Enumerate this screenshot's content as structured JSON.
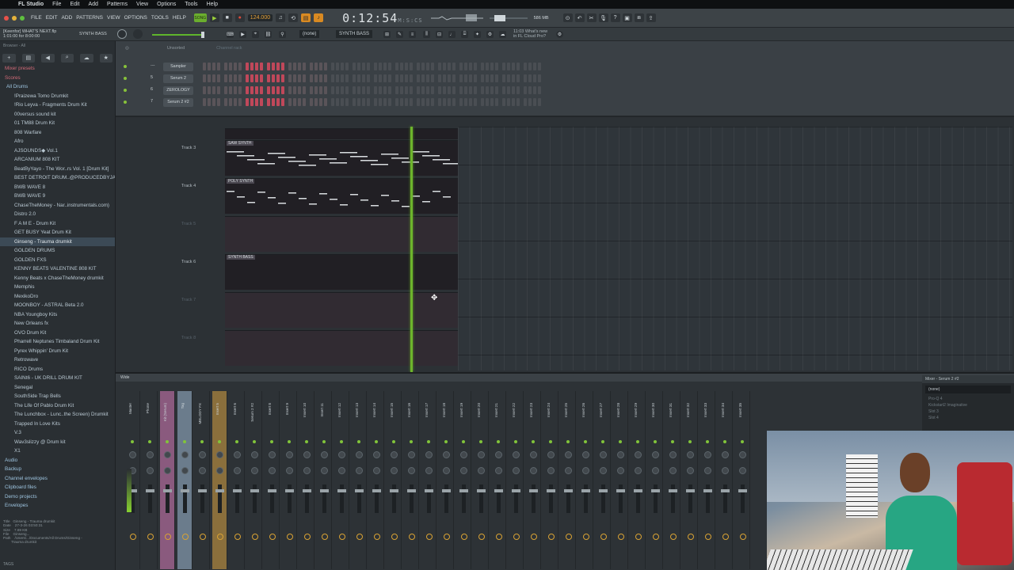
{
  "mac_menu": {
    "app": "FL Studio",
    "items": [
      "File",
      "Edit",
      "Add",
      "Patterns",
      "View",
      "Options",
      "Tools",
      "Help"
    ]
  },
  "toolbar": {
    "menu": [
      "FILE",
      "EDIT",
      "ADD",
      "PATTERNS",
      "VIEW",
      "OPTIONS",
      "TOOLS",
      "HELP"
    ],
    "mode": "SONG",
    "tempo": "124.000",
    "time": "0:12:54",
    "time_unit": "M:S:CS",
    "cpu": "586 MB",
    "cpu_sub": "0"
  },
  "hint": {
    "line1": "[Keenfor] WHAT'S NEXT.flp",
    "line2": "1:01:00 for 8:00:00"
  },
  "synth_label": "SYNTH BASS",
  "pattern_none": "(none)",
  "pattern_selector": "SYNTH BASS",
  "news": {
    "line1": "11:03 What's new",
    "line2": "in FL Cloud Pro?"
  },
  "browser": {
    "header": "Browser - All",
    "top": [
      "Mixer presets",
      "Scores"
    ],
    "folder": "All Drums",
    "items": [
      "!Praizewa Tomo Drumkit",
      "!Rio Leyva - Fragments Drum Kit",
      "00versus sound kit",
      "01 TM88 Drum Kit",
      "808 Warfare",
      "Afro",
      "AJSOUNDS◆ Vol.1",
      "ARCANIUM 808 KIT",
      "BeatByYayo - The Wor..rs Vol. 1 [Drum Kit]",
      "BEST DETROIT DRUM..@PRODUCEDBYJAVEN",
      "BWB WAVE 8",
      "BWB WAVE 9",
      "ChaseTheMoney - Nar..instrumentals.com)",
      "Distro 2.0",
      "F A M E - Drum Kit",
      "GET BUSY Yeat Drum Kit",
      "Ginseng - Trauma drumkit",
      "GOLDEN DRUMS",
      "GOLDEN FXS",
      "KENNY BEATS VALENTINE 808 KIT",
      "Kenny Beats x ChaseTheMoney drumkit",
      "Memphis",
      "MexikoDro",
      "MOONBOY - ASTRAL Beta 2.0",
      "NBA Youngboy Kits",
      "New Orleans fx",
      "OVO Drum Kit",
      "Pharrell Neptunes Timbaland Drum Kit",
      "Pyrex Whippin' Drum Kit",
      "Retrowave",
      "RICO Drums",
      "SAINt6 - UK DRILL DRUM KIT",
      "Senegal",
      "SouthSide Trap Bells",
      "The Life Of Pablo Drum Kit",
      "The Lunchbox - Lunc..the Screen) Drumkit",
      "Trapped In Love Kits",
      "V.3",
      "Wav3slizzy @ Drum kit",
      "X1"
    ],
    "selected_index": 16,
    "sections": [
      "Audio",
      "Backup",
      "Channel envelopes",
      "Clipboard files",
      "Demo projects",
      "Envelopes"
    ],
    "info": "Title   Ginseng - Trauma drumkit\nDate    27-3-26 03:50:31\nSize    7.69 KB\nFile    Ginseng...\nPath    /Users/.../Documents/All Drums/Ginseng -\n        Trauma drumkit",
    "tags": "TAGS"
  },
  "rack": {
    "filter": "Unsorted",
    "title": "Channel rack",
    "channels": [
      {
        "num": "---",
        "name": "Sampler"
      },
      {
        "num": "5",
        "name": "Serum 2"
      },
      {
        "num": "6",
        "name": "ZEROLOGY"
      },
      {
        "num": "7",
        "name": "Serum 2 #2"
      }
    ]
  },
  "playlist": {
    "tracks": [
      "Track 3",
      "Track 4",
      "Track 5",
      "Track 6",
      "Track 7",
      "Track 8"
    ],
    "clips": [
      "SAW SYNTH",
      "POLY SYNTH",
      "SYNTH BASS"
    ]
  },
  "mixer": {
    "label": "Wide",
    "strips": [
      "Master",
      "Phone",
      "Kit (Serum)",
      "Tag",
      "MELODY FX",
      "Insert 5",
      "Insert 6",
      "Serum 2 #2",
      "Insert 8",
      "Insert 9",
      "Insert 10",
      "Insert 11",
      "Insert 12",
      "Insert 13",
      "Insert 14",
      "Insert 15",
      "Insert 16",
      "Insert 17",
      "Insert 18",
      "Insert 19",
      "Insert 20",
      "Insert 21",
      "Insert 22",
      "Insert 23",
      "Insert 24",
      "Insert 25",
      "Insert 26",
      "Insert 27",
      "Insert 28",
      "Insert 29",
      "Insert 30",
      "Insert 31",
      "Insert 32",
      "Insert 33",
      "Insert 34",
      "Insert 35"
    ],
    "panel": {
      "title": "Mixer - Serum 2 #2",
      "preset": "(none)",
      "slots": [
        "Pro-Q 4",
        "Kickstart2 Imaginative",
        "Slot 3",
        "Slot 4"
      ]
    }
  }
}
